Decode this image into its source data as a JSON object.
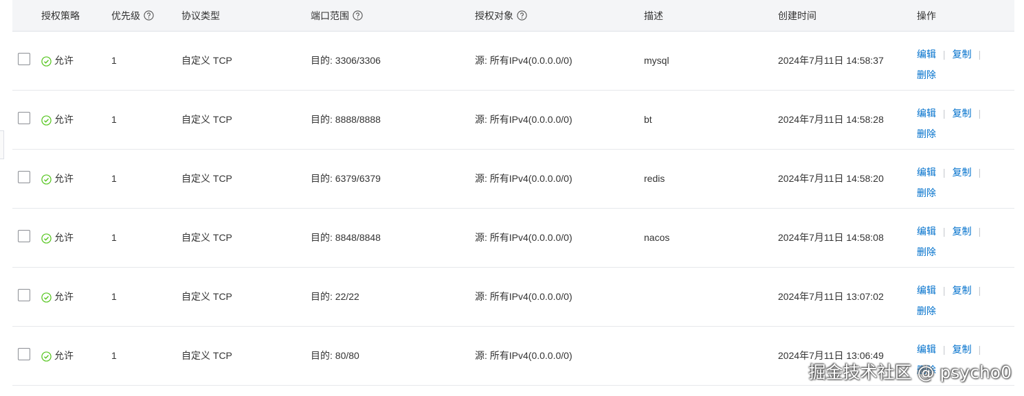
{
  "columns": {
    "policy": "授权策略",
    "priority": "优先级",
    "protocol": "协议类型",
    "port_range": "端口范围",
    "auth_object": "授权对象",
    "description": "描述",
    "created": "创建时间",
    "actions": "操作"
  },
  "actions": {
    "edit": "编辑",
    "copy": "复制",
    "delete": "删除",
    "separator": "|"
  },
  "rows": [
    {
      "policy": "允许",
      "priority": "1",
      "protocol": "自定义 TCP",
      "port": "目的: 3306/3306",
      "source": "源: 所有IPv4(0.0.0.0/0)",
      "description": "mysql",
      "created": "2024年7月11日 14:58:37"
    },
    {
      "policy": "允许",
      "priority": "1",
      "protocol": "自定义 TCP",
      "port": "目的: 8888/8888",
      "source": "源: 所有IPv4(0.0.0.0/0)",
      "description": "bt",
      "created": "2024年7月11日 14:58:28"
    },
    {
      "policy": "允许",
      "priority": "1",
      "protocol": "自定义 TCP",
      "port": "目的: 6379/6379",
      "source": "源: 所有IPv4(0.0.0.0/0)",
      "description": "redis",
      "created": "2024年7月11日 14:58:20"
    },
    {
      "policy": "允许",
      "priority": "1",
      "protocol": "自定义 TCP",
      "port": "目的: 8848/8848",
      "source": "源: 所有IPv4(0.0.0.0/0)",
      "description": "nacos",
      "created": "2024年7月11日 14:58:08"
    },
    {
      "policy": "允许",
      "priority": "1",
      "protocol": "自定义 TCP",
      "port": "目的: 22/22",
      "source": "源: 所有IPv4(0.0.0.0/0)",
      "description": "",
      "created": "2024年7月11日 13:07:02"
    },
    {
      "policy": "允许",
      "priority": "1",
      "protocol": "自定义 TCP",
      "port": "目的: 80/80",
      "source": "源: 所有IPv4(0.0.0.0/0)",
      "description": "",
      "created": "2024年7月11日 13:06:49"
    }
  ],
  "watermark": "掘金技术社区 @ psycho0",
  "colors": {
    "link": "#0070cc",
    "allow_icon": "#52c41a",
    "header_bg": "#f4f5f7"
  },
  "icons": {
    "help": "question-circle-icon",
    "allow": "check-circle-icon"
  }
}
